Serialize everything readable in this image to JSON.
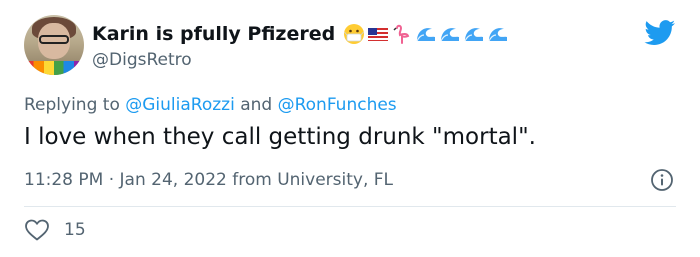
{
  "tweet": {
    "display_name": "Karin is pfully Pfizered",
    "handle": "@DigsRetro",
    "reply_prefix": "Replying to",
    "reply_mention_1": "@GiuliaRozzi",
    "reply_and": "and",
    "reply_mention_2": "@RonFunches",
    "text": "I love when they call getting drunk \"mortal\".",
    "meta": "11:28 PM · Jan 24, 2022 from University, FL",
    "like_count": "15"
  },
  "icons": {
    "name_emojis": [
      "face-with-medical-mask-icon",
      "us-flag-icon",
      "flamingo-icon",
      "wave-icon",
      "wave-icon",
      "wave-icon",
      "wave-icon"
    ],
    "logo": "twitter-bird-icon",
    "info": "info-icon",
    "like": "heart-outline-icon"
  },
  "colors": {
    "brand_blue": "#1d9bf0",
    "text_primary": "#0f1419",
    "text_secondary": "#536471"
  }
}
